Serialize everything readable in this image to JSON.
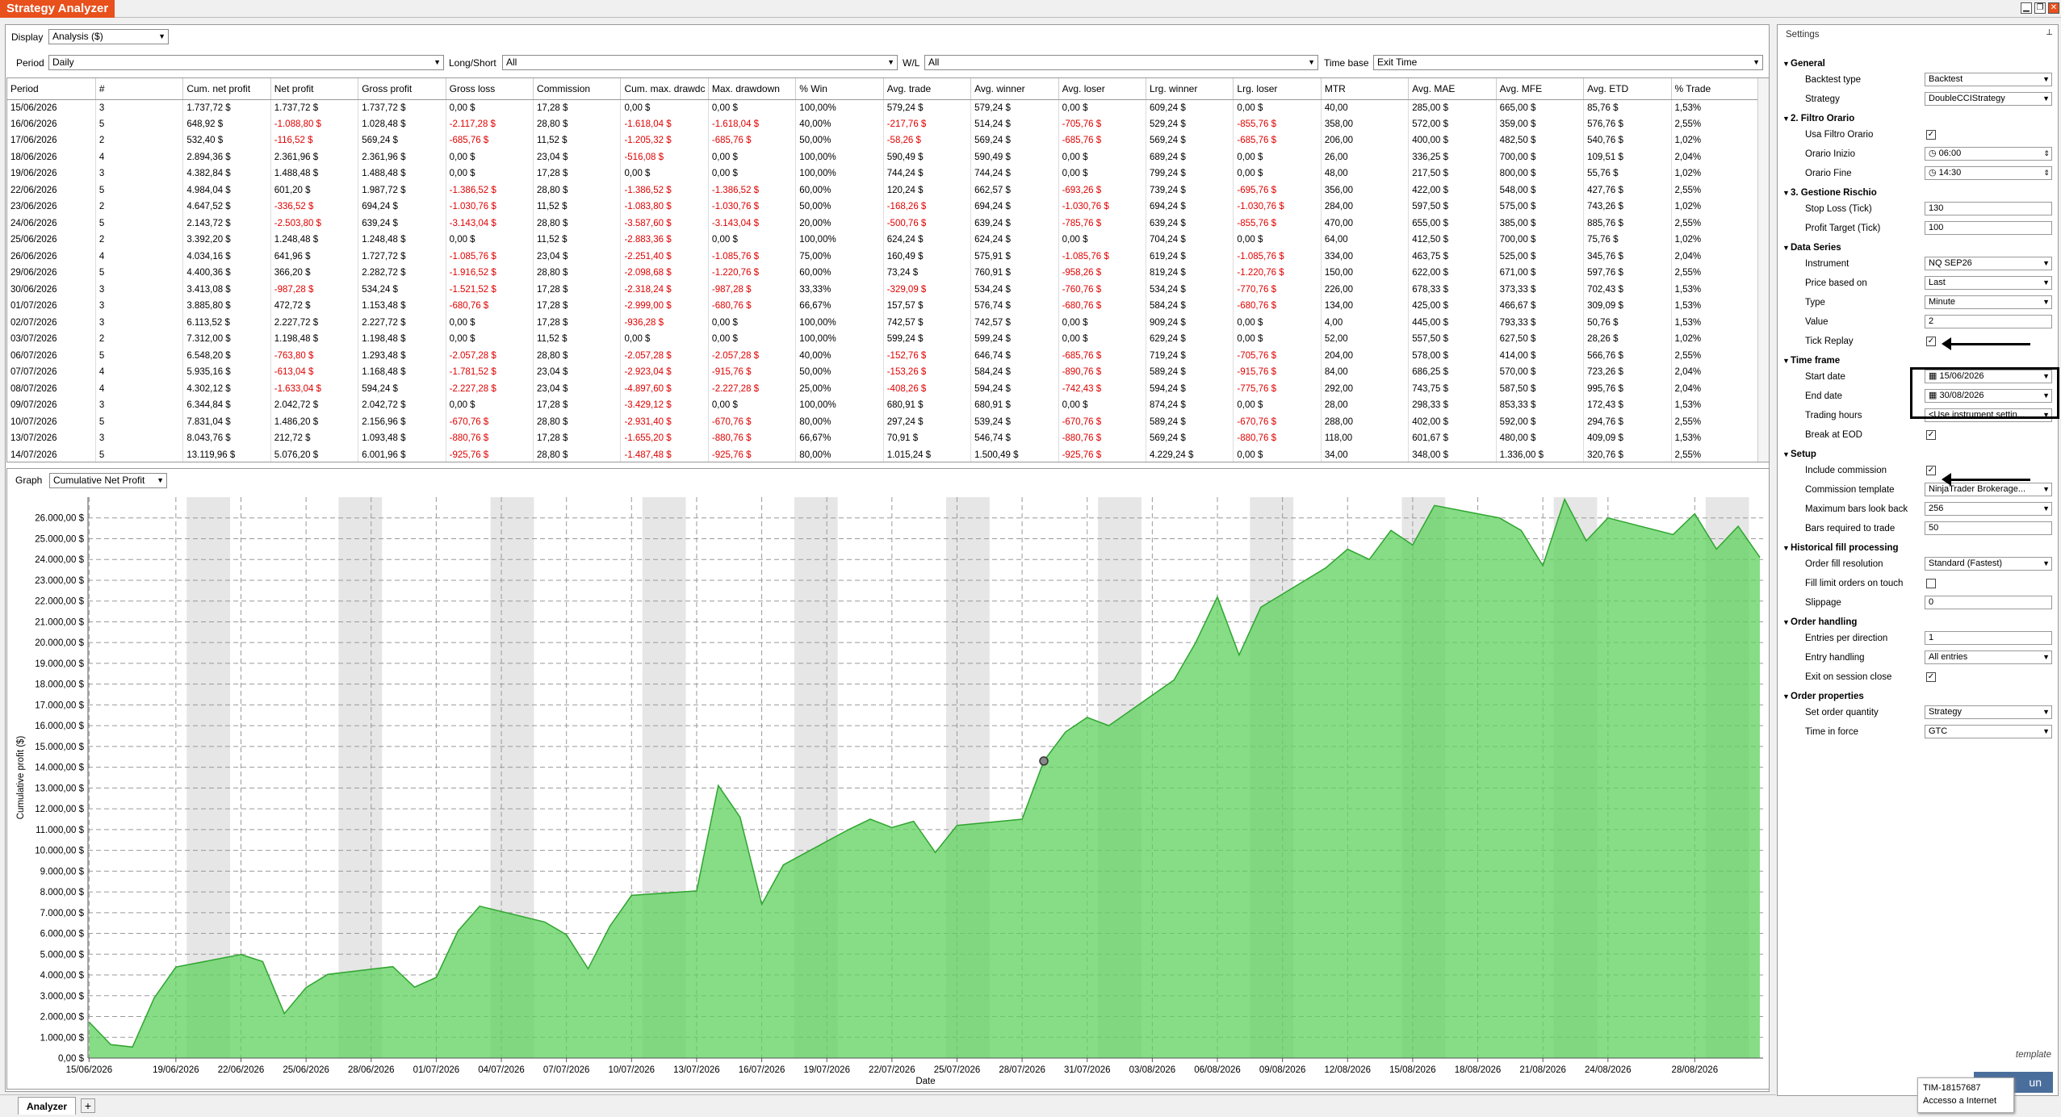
{
  "window": {
    "title": "Strategy Analyzer",
    "min": "▁",
    "restore": "❐",
    "close": "✕"
  },
  "toolbar": {
    "display_label": "Display",
    "display_value": "Analysis ($)",
    "period_label": "Period",
    "period_value": "Daily",
    "longshort_label": "Long/Short",
    "longshort_value": "All",
    "wl_label": "W/L",
    "wl_value": "All",
    "timebase_label": "Time base",
    "timebase_value": "Exit Time"
  },
  "grid": {
    "columns": [
      "Period",
      "#",
      "Cum. net profit",
      "Net profit",
      "Gross profit",
      "Gross loss",
      "Commission",
      "Cum. max. drawdc",
      "Max. drawdown",
      "% Win",
      "Avg. trade",
      "Avg. winner",
      "Avg. loser",
      "Lrg. winner",
      "Lrg. loser",
      "MTR",
      "Avg. MAE",
      "Avg. MFE",
      "Avg. ETD",
      "% Trade"
    ],
    "rows": [
      [
        "15/06/2026",
        "3",
        "1.737,72 $",
        "1.737,72 $",
        "1.737,72 $",
        "0,00 $",
        "17,28 $",
        "0,00 $",
        "0,00 $",
        "100,00%",
        "579,24 $",
        "579,24 $",
        "0,00 $",
        "609,24 $",
        "0,00 $",
        "40,00",
        "285,00 $",
        "665,00 $",
        "85,76 $",
        "1,53%"
      ],
      [
        "16/06/2026",
        "5",
        "648,92 $",
        "-1.088,80 $",
        "1.028,48 $",
        "-2.117,28 $",
        "28,80 $",
        "-1.618,04 $",
        "-1.618,04 $",
        "40,00%",
        "-217,76 $",
        "514,24 $",
        "-705,76 $",
        "529,24 $",
        "-855,76 $",
        "358,00",
        "572,00 $",
        "359,00 $",
        "576,76 $",
        "2,55%"
      ],
      [
        "17/06/2026",
        "2",
        "532,40 $",
        "-116,52 $",
        "569,24 $",
        "-685,76 $",
        "11,52 $",
        "-1.205,32 $",
        "-685,76 $",
        "50,00%",
        "-58,26 $",
        "569,24 $",
        "-685,76 $",
        "569,24 $",
        "-685,76 $",
        "206,00",
        "400,00 $",
        "482,50 $",
        "540,76 $",
        "1,02%"
      ],
      [
        "18/06/2026",
        "4",
        "2.894,36 $",
        "2.361,96 $",
        "2.361,96 $",
        "0,00 $",
        "23,04 $",
        "-516,08 $",
        "0,00 $",
        "100,00%",
        "590,49 $",
        "590,49 $",
        "0,00 $",
        "689,24 $",
        "0,00 $",
        "26,00",
        "336,25 $",
        "700,00 $",
        "109,51 $",
        "2,04%"
      ],
      [
        "19/06/2026",
        "3",
        "4.382,84 $",
        "1.488,48 $",
        "1.488,48 $",
        "0,00 $",
        "17,28 $",
        "0,00 $",
        "0,00 $",
        "100,00%",
        "744,24 $",
        "744,24 $",
        "0,00 $",
        "799,24 $",
        "0,00 $",
        "48,00",
        "217,50 $",
        "800,00 $",
        "55,76 $",
        "1,02%"
      ],
      [
        "22/06/2026",
        "5",
        "4.984,04 $",
        "601,20 $",
        "1.987,72 $",
        "-1.386,52 $",
        "28,80 $",
        "-1.386,52 $",
        "-1.386,52 $",
        "60,00%",
        "120,24 $",
        "662,57 $",
        "-693,26 $",
        "739,24 $",
        "-695,76 $",
        "356,00",
        "422,00 $",
        "548,00 $",
        "427,76 $",
        "2,55%"
      ],
      [
        "23/06/2026",
        "2",
        "4.647,52 $",
        "-336,52 $",
        "694,24 $",
        "-1.030,76 $",
        "11,52 $",
        "-1.083,80 $",
        "-1.030,76 $",
        "50,00%",
        "-168,26 $",
        "694,24 $",
        "-1.030,76 $",
        "694,24 $",
        "-1.030,76 $",
        "284,00",
        "597,50 $",
        "575,00 $",
        "743,26 $",
        "1,02%"
      ],
      [
        "24/06/2026",
        "5",
        "2.143,72 $",
        "-2.503,80 $",
        "639,24 $",
        "-3.143,04 $",
        "28,80 $",
        "-3.587,60 $",
        "-3.143,04 $",
        "20,00%",
        "-500,76 $",
        "639,24 $",
        "-785,76 $",
        "639,24 $",
        "-855,76 $",
        "470,00",
        "655,00 $",
        "385,00 $",
        "885,76 $",
        "2,55%"
      ],
      [
        "25/06/2026",
        "2",
        "3.392,20 $",
        "1.248,48 $",
        "1.248,48 $",
        "0,00 $",
        "11,52 $",
        "-2.883,36 $",
        "0,00 $",
        "100,00%",
        "624,24 $",
        "624,24 $",
        "0,00 $",
        "704,24 $",
        "0,00 $",
        "64,00",
        "412,50 $",
        "700,00 $",
        "75,76 $",
        "1,02%"
      ],
      [
        "26/06/2026",
        "4",
        "4.034,16 $",
        "641,96 $",
        "1.727,72 $",
        "-1.085,76 $",
        "23,04 $",
        "-2.251,40 $",
        "-1.085,76 $",
        "75,00%",
        "160,49 $",
        "575,91 $",
        "-1.085,76 $",
        "619,24 $",
        "-1.085,76 $",
        "334,00",
        "463,75 $",
        "525,00 $",
        "345,76 $",
        "2,04%"
      ],
      [
        "29/06/2026",
        "5",
        "4.400,36 $",
        "366,20 $",
        "2.282,72 $",
        "-1.916,52 $",
        "28,80 $",
        "-2.098,68 $",
        "-1.220,76 $",
        "60,00%",
        "73,24 $",
        "760,91 $",
        "-958,26 $",
        "819,24 $",
        "-1.220,76 $",
        "150,00",
        "622,00 $",
        "671,00 $",
        "597,76 $",
        "2,55%"
      ],
      [
        "30/06/2026",
        "3",
        "3.413,08 $",
        "-987,28 $",
        "534,24 $",
        "-1.521,52 $",
        "17,28 $",
        "-2.318,24 $",
        "-987,28 $",
        "33,33%",
        "-329,09 $",
        "534,24 $",
        "-760,76 $",
        "534,24 $",
        "-770,76 $",
        "226,00",
        "678,33 $",
        "373,33 $",
        "702,43 $",
        "1,53%"
      ],
      [
        "01/07/2026",
        "3",
        "3.885,80 $",
        "472,72 $",
        "1.153,48 $",
        "-680,76 $",
        "17,28 $",
        "-2.999,00 $",
        "-680,76 $",
        "66,67%",
        "157,57 $",
        "576,74 $",
        "-680,76 $",
        "584,24 $",
        "-680,76 $",
        "134,00",
        "425,00 $",
        "466,67 $",
        "309,09 $",
        "1,53%"
      ],
      [
        "02/07/2026",
        "3",
        "6.113,52 $",
        "2.227,72 $",
        "2.227,72 $",
        "0,00 $",
        "17,28 $",
        "-936,28 $",
        "0,00 $",
        "100,00%",
        "742,57 $",
        "742,57 $",
        "0,00 $",
        "909,24 $",
        "0,00 $",
        "4,00",
        "445,00 $",
        "793,33 $",
        "50,76 $",
        "1,53%"
      ],
      [
        "03/07/2026",
        "2",
        "7.312,00 $",
        "1.198,48 $",
        "1.198,48 $",
        "0,00 $",
        "11,52 $",
        "0,00 $",
        "0,00 $",
        "100,00%",
        "599,24 $",
        "599,24 $",
        "0,00 $",
        "629,24 $",
        "0,00 $",
        "52,00",
        "557,50 $",
        "627,50 $",
        "28,26 $",
        "1,02%"
      ],
      [
        "06/07/2026",
        "5",
        "6.548,20 $",
        "-763,80 $",
        "1.293,48 $",
        "-2.057,28 $",
        "28,80 $",
        "-2.057,28 $",
        "-2.057,28 $",
        "40,00%",
        "-152,76 $",
        "646,74 $",
        "-685,76 $",
        "719,24 $",
        "-705,76 $",
        "204,00",
        "578,00 $",
        "414,00 $",
        "566,76 $",
        "2,55%"
      ],
      [
        "07/07/2026",
        "4",
        "5.935,16 $",
        "-613,04 $",
        "1.168,48 $",
        "-1.781,52 $",
        "23,04 $",
        "-2.923,04 $",
        "-915,76 $",
        "50,00%",
        "-153,26 $",
        "584,24 $",
        "-890,76 $",
        "589,24 $",
        "-915,76 $",
        "84,00",
        "686,25 $",
        "570,00 $",
        "723,26 $",
        "2,04%"
      ],
      [
        "08/07/2026",
        "4",
        "4.302,12 $",
        "-1.633,04 $",
        "594,24 $",
        "-2.227,28 $",
        "23,04 $",
        "-4.897,60 $",
        "-2.227,28 $",
        "25,00%",
        "-408,26 $",
        "594,24 $",
        "-742,43 $",
        "594,24 $",
        "-775,76 $",
        "292,00",
        "743,75 $",
        "587,50 $",
        "995,76 $",
        "2,04%"
      ],
      [
        "09/07/2026",
        "3",
        "6.344,84 $",
        "2.042,72 $",
        "2.042,72 $",
        "0,00 $",
        "17,28 $",
        "-3.429,12 $",
        "0,00 $",
        "100,00%",
        "680,91 $",
        "680,91 $",
        "0,00 $",
        "874,24 $",
        "0,00 $",
        "28,00",
        "298,33 $",
        "853,33 $",
        "172,43 $",
        "1,53%"
      ],
      [
        "10/07/2026",
        "5",
        "7.831,04 $",
        "1.486,20 $",
        "2.156,96 $",
        "-670,76 $",
        "28,80 $",
        "-2.931,40 $",
        "-670,76 $",
        "80,00%",
        "297,24 $",
        "539,24 $",
        "-670,76 $",
        "589,24 $",
        "-670,76 $",
        "288,00",
        "402,00 $",
        "592,00 $",
        "294,76 $",
        "2,55%"
      ],
      [
        "13/07/2026",
        "3",
        "8.043,76 $",
        "212,72 $",
        "1.093,48 $",
        "-880,76 $",
        "17,28 $",
        "-1.655,20 $",
        "-880,76 $",
        "66,67%",
        "70,91 $",
        "546,74 $",
        "-880,76 $",
        "569,24 $",
        "-880,76 $",
        "118,00",
        "601,67 $",
        "480,00 $",
        "409,09 $",
        "1,53%"
      ],
      [
        "14/07/2026",
        "5",
        "13.119,96 $",
        "5.076,20 $",
        "6.001,96 $",
        "-925,76 $",
        "28,80 $",
        "-1.487,48 $",
        "-925,76 $",
        "80,00%",
        "1.015,24 $",
        "1.500,49 $",
        "-925,76 $",
        "4.229,24 $",
        "0,00 $",
        "34,00",
        "348,00 $",
        "1.336,00 $",
        "320,76 $",
        "2,55%"
      ]
    ]
  },
  "graph": {
    "label": "Graph",
    "value": "Cumulative Net Profit"
  },
  "chart_data": {
    "type": "area",
    "ylabel": "Cumulative profit ($)",
    "xlabel": "Date",
    "ylim": [
      0,
      27000
    ],
    "y_ticks": [
      "0,00 $",
      "1.000,00 $",
      "2.000,00 $",
      "3.000,00 $",
      "4.000,00 $",
      "5.000,00 $",
      "6.000,00 $",
      "7.000,00 $",
      "8.000,00 $",
      "9.000,00 $",
      "10.000,00 $",
      "11.000,00 $",
      "12.000,00 $",
      "13.000,00 $",
      "14.000,00 $",
      "15.000,00 $",
      "16.000,00 $",
      "17.000,00 $",
      "18.000,00 $",
      "19.000,00 $",
      "20.000,00 $",
      "21.000,00 $",
      "22.000,00 $",
      "23.000,00 $",
      "24.000,00 $",
      "25.000,00 $",
      "26.000,00 $"
    ],
    "x_ticks": [
      "15/06/2026",
      "19/06/2026",
      "22/06/2026",
      "25/06/2026",
      "28/06/2026",
      "01/07/2026",
      "04/07/2026",
      "07/07/2026",
      "10/07/2026",
      "13/07/2026",
      "16/07/2026",
      "19/07/2026",
      "22/07/2026",
      "25/07/2026",
      "28/07/2026",
      "31/07/2026",
      "03/08/2026",
      "06/08/2026",
      "09/08/2026",
      "12/08/2026",
      "15/08/2026",
      "18/08/2026",
      "21/08/2026",
      "24/08/2026",
      "28/08/2026"
    ],
    "x_day_range": [
      0,
      75
    ],
    "series": [
      {
        "points": [
          [
            0,
            1738
          ],
          [
            1,
            649
          ],
          [
            2,
            532
          ],
          [
            3,
            2894
          ],
          [
            4,
            4383
          ],
          [
            7,
            4984
          ],
          [
            8,
            4648
          ],
          [
            9,
            2144
          ],
          [
            10,
            3392
          ],
          [
            11,
            4034
          ],
          [
            14,
            4400
          ],
          [
            15,
            3413
          ],
          [
            16,
            3886
          ],
          [
            17,
            6114
          ],
          [
            18,
            7312
          ],
          [
            21,
            6548
          ],
          [
            22,
            5935
          ],
          [
            23,
            4302
          ],
          [
            24,
            6345
          ],
          [
            25,
            7831
          ],
          [
            28,
            8044
          ],
          [
            29,
            13120
          ],
          [
            30,
            11600
          ],
          [
            31,
            7400
          ],
          [
            32,
            9300
          ],
          [
            35,
            11000
          ],
          [
            36,
            11500
          ],
          [
            37,
            11100
          ],
          [
            38,
            11400
          ],
          [
            39,
            9900
          ],
          [
            40,
            11200
          ],
          [
            43,
            11500
          ],
          [
            44,
            14300
          ],
          [
            45,
            15700
          ],
          [
            46,
            16400
          ],
          [
            47,
            16000
          ],
          [
            50,
            18200
          ],
          [
            51,
            20000
          ],
          [
            52,
            22200
          ],
          [
            53,
            19400
          ],
          [
            54,
            21700
          ],
          [
            57,
            23600
          ],
          [
            58,
            24500
          ],
          [
            59,
            24000
          ],
          [
            60,
            25400
          ],
          [
            61,
            24700
          ],
          [
            62,
            26600
          ],
          [
            65,
            26000
          ],
          [
            66,
            25400
          ],
          [
            67,
            23700
          ],
          [
            68,
            26900
          ],
          [
            69,
            24900
          ],
          [
            70,
            26000
          ],
          [
            73,
            25200
          ],
          [
            74,
            26200
          ],
          [
            75,
            24500
          ],
          [
            76,
            25600
          ],
          [
            77,
            24100
          ]
        ]
      }
    ],
    "marker_day": 44
  },
  "tabs": {
    "analyzer": "Analyzer",
    "add": "+"
  },
  "settings": {
    "title": "Settings",
    "pin": "📌",
    "rows": [
      {
        "type": "cat",
        "name": "General"
      },
      {
        "type": "select",
        "name": "Backtest type",
        "value": "Backtest"
      },
      {
        "type": "select",
        "name": "Strategy",
        "value": "DoubleCCIStrategy"
      },
      {
        "type": "cat",
        "name": "2. Filtro Orario"
      },
      {
        "type": "check",
        "name": "Usa Filtro Orario",
        "value": "✓"
      },
      {
        "type": "time",
        "name": "Orario Inizio",
        "value": "06:00"
      },
      {
        "type": "time",
        "name": "Orario Fine",
        "value": "14:30"
      },
      {
        "type": "cat",
        "name": "3. Gestione Rischio"
      },
      {
        "type": "text",
        "name": "Stop Loss (Tick)",
        "value": "130"
      },
      {
        "type": "text",
        "name": "Profit Target (Tick)",
        "value": "100"
      },
      {
        "type": "cat",
        "name": "Data Series"
      },
      {
        "type": "select",
        "name": "Instrument",
        "value": "NQ SEP26"
      },
      {
        "type": "select",
        "name": "Price based on",
        "value": "Last"
      },
      {
        "type": "select",
        "name": "Type",
        "value": "Minute"
      },
      {
        "type": "text",
        "name": "Value",
        "value": "2"
      },
      {
        "type": "check",
        "name": "Tick Replay",
        "value": "✓"
      },
      {
        "type": "cat",
        "name": "Time frame"
      },
      {
        "type": "date",
        "name": "Start date",
        "value": "15/06/2026"
      },
      {
        "type": "date",
        "name": "End date",
        "value": "30/08/2026"
      },
      {
        "type": "select",
        "name": "Trading hours",
        "value": "<Use instrument settin..."
      },
      {
        "type": "check",
        "name": "Break at EOD",
        "value": "✓"
      },
      {
        "type": "cat",
        "name": "Setup"
      },
      {
        "type": "check",
        "name": "Include commission",
        "value": "✓"
      },
      {
        "type": "select",
        "name": "Commission template",
        "value": "NinjaTrader Brokerage..."
      },
      {
        "type": "select",
        "name": "Maximum bars look back",
        "value": "256"
      },
      {
        "type": "text",
        "name": "Bars required to trade",
        "value": "50"
      },
      {
        "type": "cat",
        "name": "Historical fill processing"
      },
      {
        "type": "select",
        "name": "Order fill resolution",
        "value": "Standard (Fastest)"
      },
      {
        "type": "check",
        "name": "Fill limit orders on touch",
        "value": ""
      },
      {
        "type": "text",
        "name": "Slippage",
        "value": "0"
      },
      {
        "type": "cat",
        "name": "Order handling"
      },
      {
        "type": "text",
        "name": "Entries per direction",
        "value": "1"
      },
      {
        "type": "select",
        "name": "Entry handling",
        "value": "All entries"
      },
      {
        "type": "check",
        "name": "Exit on session close",
        "value": "✓"
      },
      {
        "type": "cat",
        "name": "Order properties"
      },
      {
        "type": "select",
        "name": "Set order quantity",
        "value": "Strategy"
      },
      {
        "type": "select",
        "name": "Time in force",
        "value": "GTC"
      }
    ],
    "template_label": "template",
    "run_label": "un"
  },
  "tooltip": {
    "line1": "TIM-18157687",
    "line2": "Accesso a Internet"
  }
}
